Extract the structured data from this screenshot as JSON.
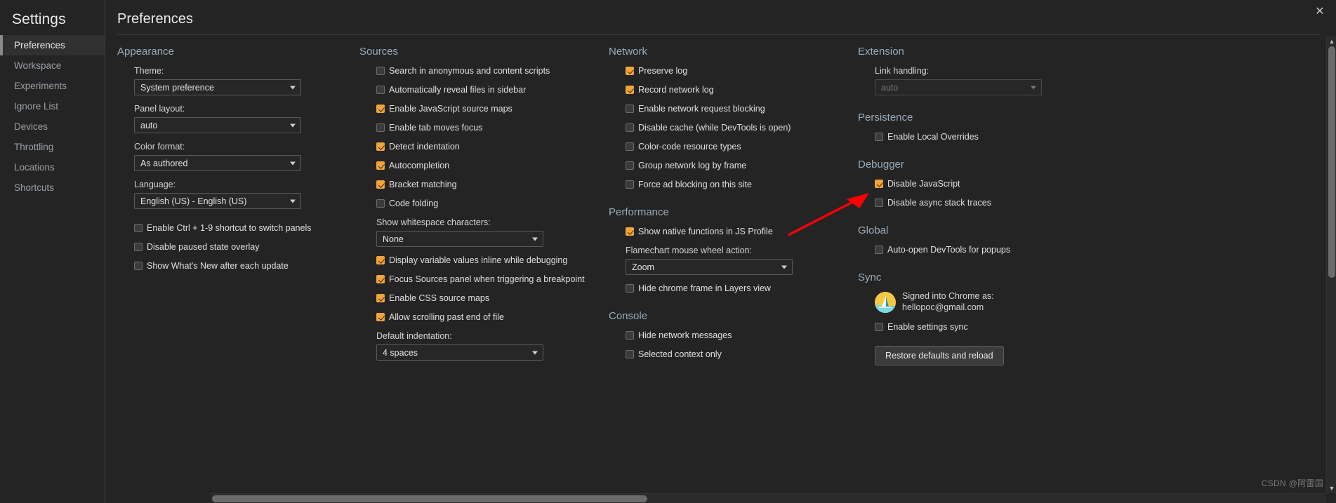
{
  "window": {
    "close_label": "✕"
  },
  "sidebar": {
    "title": "Settings",
    "items": [
      {
        "label": "Preferences",
        "selected": true
      },
      {
        "label": "Workspace",
        "selected": false
      },
      {
        "label": "Experiments",
        "selected": false
      },
      {
        "label": "Ignore List",
        "selected": false
      },
      {
        "label": "Devices",
        "selected": false
      },
      {
        "label": "Throttling",
        "selected": false
      },
      {
        "label": "Locations",
        "selected": false
      },
      {
        "label": "Shortcuts",
        "selected": false
      }
    ]
  },
  "page": {
    "title": "Preferences"
  },
  "appearance": {
    "title": "Appearance",
    "theme_label": "Theme:",
    "theme_value": "System preference",
    "panel_layout_label": "Panel layout:",
    "panel_layout_value": "auto",
    "color_format_label": "Color format:",
    "color_format_value": "As authored",
    "language_label": "Language:",
    "language_value": "English (US) - English (US)",
    "checkboxes": [
      {
        "label": "Enable Ctrl + 1-9 shortcut to switch panels",
        "checked": false
      },
      {
        "label": "Disable paused state overlay",
        "checked": false
      },
      {
        "label": "Show What's New after each update",
        "checked": false
      }
    ]
  },
  "sources": {
    "title": "Sources",
    "checkboxes_top": [
      {
        "label": "Search in anonymous and content scripts",
        "checked": false
      },
      {
        "label": "Automatically reveal files in sidebar",
        "checked": false
      },
      {
        "label": "Enable JavaScript source maps",
        "checked": true
      },
      {
        "label": "Enable tab moves focus",
        "checked": false
      },
      {
        "label": "Detect indentation",
        "checked": true
      },
      {
        "label": "Autocompletion",
        "checked": true
      },
      {
        "label": "Bracket matching",
        "checked": true
      },
      {
        "label": "Code folding",
        "checked": false
      }
    ],
    "whitespace_label": "Show whitespace characters:",
    "whitespace_value": "None",
    "checkboxes_bottom": [
      {
        "label": "Display variable values inline while debugging",
        "checked": true
      },
      {
        "label": "Focus Sources panel when triggering a breakpoint",
        "checked": true
      },
      {
        "label": "Enable CSS source maps",
        "checked": true
      },
      {
        "label": "Allow scrolling past end of file",
        "checked": true
      }
    ],
    "indentation_label": "Default indentation:",
    "indentation_value": "4 spaces"
  },
  "network": {
    "title": "Network",
    "checkboxes": [
      {
        "label": "Preserve log",
        "checked": true
      },
      {
        "label": "Record network log",
        "checked": true
      },
      {
        "label": "Enable network request blocking",
        "checked": false
      },
      {
        "label": "Disable cache (while DevTools is open)",
        "checked": false
      },
      {
        "label": "Color-code resource types",
        "checked": false
      },
      {
        "label": "Group network log by frame",
        "checked": false
      },
      {
        "label": "Force ad blocking on this site",
        "checked": false
      }
    ]
  },
  "performance": {
    "title": "Performance",
    "checkbox_native": {
      "label": "Show native functions in JS Profile",
      "checked": true
    },
    "flamechart_label": "Flamechart mouse wheel action:",
    "flamechart_value": "Zoom",
    "checkbox_hide_chrome": {
      "label": "Hide chrome frame in Layers view",
      "checked": false
    }
  },
  "console": {
    "title": "Console",
    "checkboxes": [
      {
        "label": "Hide network messages",
        "checked": false
      },
      {
        "label": "Selected context only",
        "checked": false
      }
    ]
  },
  "extension": {
    "title": "Extension",
    "link_handling_label": "Link handling:",
    "link_handling_value": "auto"
  },
  "persistence": {
    "title": "Persistence",
    "checkboxes": [
      {
        "label": "Enable Local Overrides",
        "checked": false
      }
    ]
  },
  "debugger": {
    "title": "Debugger",
    "checkboxes": [
      {
        "label": "Disable JavaScript",
        "checked": true
      },
      {
        "label": "Disable async stack traces",
        "checked": false
      }
    ]
  },
  "global": {
    "title": "Global",
    "checkboxes": [
      {
        "label": "Auto-open DevTools for popups",
        "checked": false
      }
    ]
  },
  "sync": {
    "title": "Sync",
    "signed_in_line1": "Signed into Chrome as:",
    "signed_in_line2": "hellopoc@gmail.com",
    "checkbox_sync": {
      "label": "Enable settings sync",
      "checked": false
    },
    "restore_button": "Restore defaults and reload"
  },
  "annotation": {
    "arrow_color": "#ff0000",
    "target": "Disable JavaScript"
  },
  "watermark": "CSDN @阿雷国",
  "colors": {
    "background": "#242424",
    "sidebar": "#242424",
    "checkbox_accent": "#f2a33c",
    "section_header": "#9aacbb",
    "text": "#e0e0e0"
  }
}
